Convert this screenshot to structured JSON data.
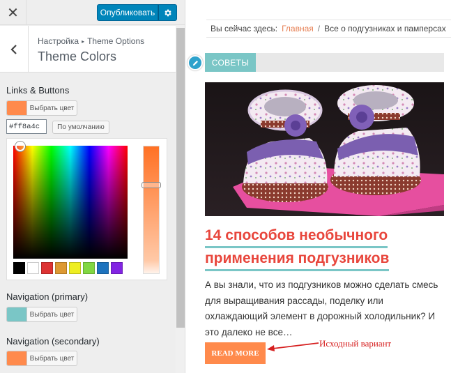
{
  "topbar": {
    "close_icon": "close-icon",
    "publish_label": "Опубликовать",
    "gear_icon": "gear-icon"
  },
  "section": {
    "crumb_parent": "Настройка",
    "crumb_separator": "▸",
    "crumb_child": "Theme Options",
    "title": "Theme Colors",
    "back_icon": "chevron-left-icon"
  },
  "controls": {
    "links_buttons": {
      "label": "Links & Buttons",
      "button_label": "Выбрать цвет",
      "color": "#ff8a4c",
      "hex_value": "#ff8a4c",
      "default_label": "По умолчанию"
    },
    "nav_primary": {
      "label": "Navigation (primary)",
      "button_label": "Выбрать цвет",
      "color": "#7ac6c6"
    },
    "nav_secondary": {
      "label": "Navigation (secondary)",
      "button_label": "Выбрать цвет",
      "color": "#ff8a4c"
    }
  },
  "palette": [
    "#000000",
    "#ffffff",
    "#dd3333",
    "#dd9933",
    "#eeee22",
    "#81d742",
    "#1e73be",
    "#8224e3"
  ],
  "preview": {
    "breadcrumb_prefix": "Вы сейчас здесь:",
    "breadcrumb_home": "Главная",
    "breadcrumb_slash": "/",
    "breadcrumb_current": "Все о подгузниках и памперсах",
    "category": "СОВЕТЫ",
    "post_title_line1": "14 способов необычного",
    "post_title_line2": "применения подгузников",
    "excerpt": "А вы знали, что из подгузников можно сделать смесь для выращивания рассады, поделку или охлаждающий элемент в дорожный холодильник? И это далеко не все…",
    "read_more": "READ MORE",
    "annotation": "Исходный вариант",
    "accent_color": "#e8463c",
    "underline_color": "#7ac6c6"
  }
}
